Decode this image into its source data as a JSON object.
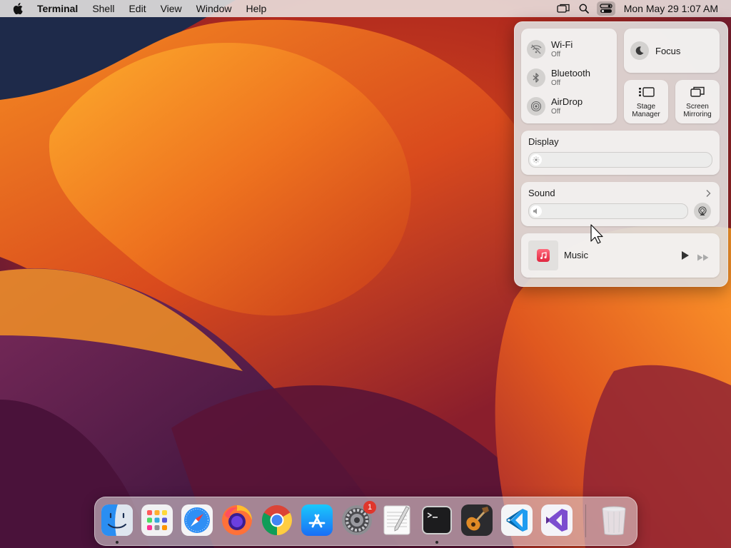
{
  "menubar": {
    "app_name": "Terminal",
    "items": [
      "Shell",
      "Edit",
      "View",
      "Window",
      "Help"
    ],
    "clock": "Mon May 29  1:07 AM"
  },
  "control_center": {
    "wifi": {
      "title": "Wi-Fi",
      "status": "Off"
    },
    "bluetooth": {
      "title": "Bluetooth",
      "status": "Off"
    },
    "airdrop": {
      "title": "AirDrop",
      "status": "Off"
    },
    "focus": {
      "label": "Focus"
    },
    "stage_manager": {
      "line1": "Stage",
      "line2": "Manager"
    },
    "screen_mirroring": {
      "line1": "Screen",
      "line2": "Mirroring"
    },
    "display": {
      "title": "Display"
    },
    "sound": {
      "title": "Sound"
    },
    "now_playing": {
      "app": "Music"
    }
  },
  "dock": {
    "apps": [
      "Finder",
      "Launchpad",
      "Safari",
      "Firefox",
      "Google Chrome",
      "App Store",
      "System Settings",
      "TextEdit",
      "Terminal",
      "GarageBand",
      "Visual Studio Code",
      "Visual Studio",
      "Trash"
    ],
    "system_settings_badge": "1"
  },
  "colors": {
    "menubar_bg": "#ECE9E6",
    "badge_red": "#E0362C",
    "wallpaper_orange": "#E8641E"
  }
}
